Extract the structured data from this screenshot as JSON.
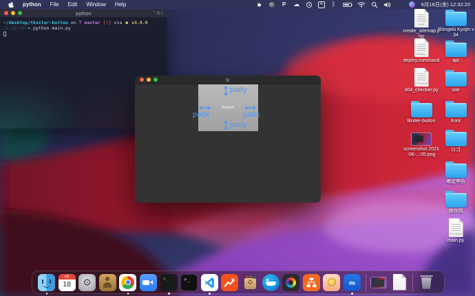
{
  "menu_bar": {
    "app_menu": "python",
    "menus": [
      "File",
      "Edit",
      "Window",
      "Help"
    ],
    "status": {
      "p_badge": "P",
      "ime": "A",
      "clock": "6月18日(金) 12:32:20"
    },
    "status_icons": [
      "hand-icon",
      "sphere-app-icon",
      "p-app-icon",
      "cloud-icon",
      "time-machine-icon",
      "ime-badge",
      "bluetooth-icon",
      "battery-icon",
      "wifi-icon",
      "spotlight-icon",
      "volume-icon",
      "control-center-icon",
      "siri-icon"
    ]
  },
  "terminal_window": {
    "title": "python",
    "shortcut_badge": "⌃⌘1",
    "prompt": {
      "path": "~/desktop/tkniter-button",
      "on_word": "on",
      "branch_icon": "ᛘ",
      "branch": "master",
      "git_status": "[!]",
      "via_word": "via",
      "python_version": "v3.9.0",
      "time": "12:32:10",
      "prompt_char": ">",
      "command": "python main.py"
    }
  },
  "tk_window": {
    "title": "tk",
    "button_label": "button",
    "pady_top": "pady",
    "pady_bottom": "pady",
    "padx_left": "padx",
    "padx_right": "padx"
  },
  "desktop": {
    "left_column": [
      {
        "label": "create_sitemap.php",
        "type": "file",
        "badge": "PHP"
      },
      {
        "label": "deploy.command",
        "type": "file",
        "badge": "SHELL"
      },
      {
        "label": "404_checker.py",
        "type": "file",
        "badge": "PYTHON"
      },
      {
        "label": "tkniter-button",
        "type": "folder"
      },
      {
        "label": "screenshot 2021-06-…05.png",
        "type": "image"
      }
    ],
    "right_column": [
      {
        "label": "Shingeki Kyojin v34",
        "type": "folder"
      },
      {
        "label": "api",
        "type": "folder"
      },
      {
        "label": "site",
        "type": "folder"
      },
      {
        "label": "front",
        "type": "folder"
      },
      {
        "label": "ロゴ",
        "type": "folder"
      },
      {
        "label": "確定申告",
        "type": "folder"
      },
      {
        "label": "保存用",
        "type": "folder"
      },
      {
        "label": "main.py",
        "type": "file",
        "badge": "PYTHON"
      }
    ]
  },
  "dock": {
    "calendar": {
      "month": "6月",
      "day": "18"
    },
    "terminal_glyph": ">_",
    "iterm_glyph": ">_",
    "infinity_glyph": "∞",
    "recycle_glyph": "♻",
    "gear_glyph": "⚙",
    "items": [
      {
        "name": "finder",
        "running": true
      },
      {
        "name": "calendar",
        "running": false
      },
      {
        "name": "system-preferences",
        "running": false
      },
      {
        "name": "contacts",
        "running": false
      },
      {
        "name": "chrome",
        "running": true
      },
      {
        "name": "zoom",
        "running": false
      },
      {
        "name": "terminal",
        "running": true
      },
      {
        "name": "iterm",
        "running": false
      },
      {
        "name": "vscode",
        "running": true
      },
      {
        "name": "chart-arrow-app",
        "running": false
      },
      {
        "name": "appcleaner",
        "running": false
      },
      {
        "name": "docker",
        "running": false
      },
      {
        "name": "quicktime",
        "running": false
      },
      {
        "name": "sitemap-app",
        "running": false
      },
      {
        "name": "database-app",
        "running": false
      },
      {
        "name": "infinity-app",
        "running": true
      },
      {
        "name": "minimized-window",
        "running": false
      },
      {
        "name": "recent-document",
        "running": false
      },
      {
        "name": "trash",
        "running": false
      }
    ]
  },
  "colors": {
    "annotation_blue": "#4f97f7",
    "folder_blue": "#41b8f5",
    "traffic_red": "#ff5f57",
    "traffic_yellow": "#febc2e",
    "traffic_green": "#28c840",
    "menubar_bg": "#32345a",
    "dock_bg": "rgba(48,28,40,0.48)"
  }
}
